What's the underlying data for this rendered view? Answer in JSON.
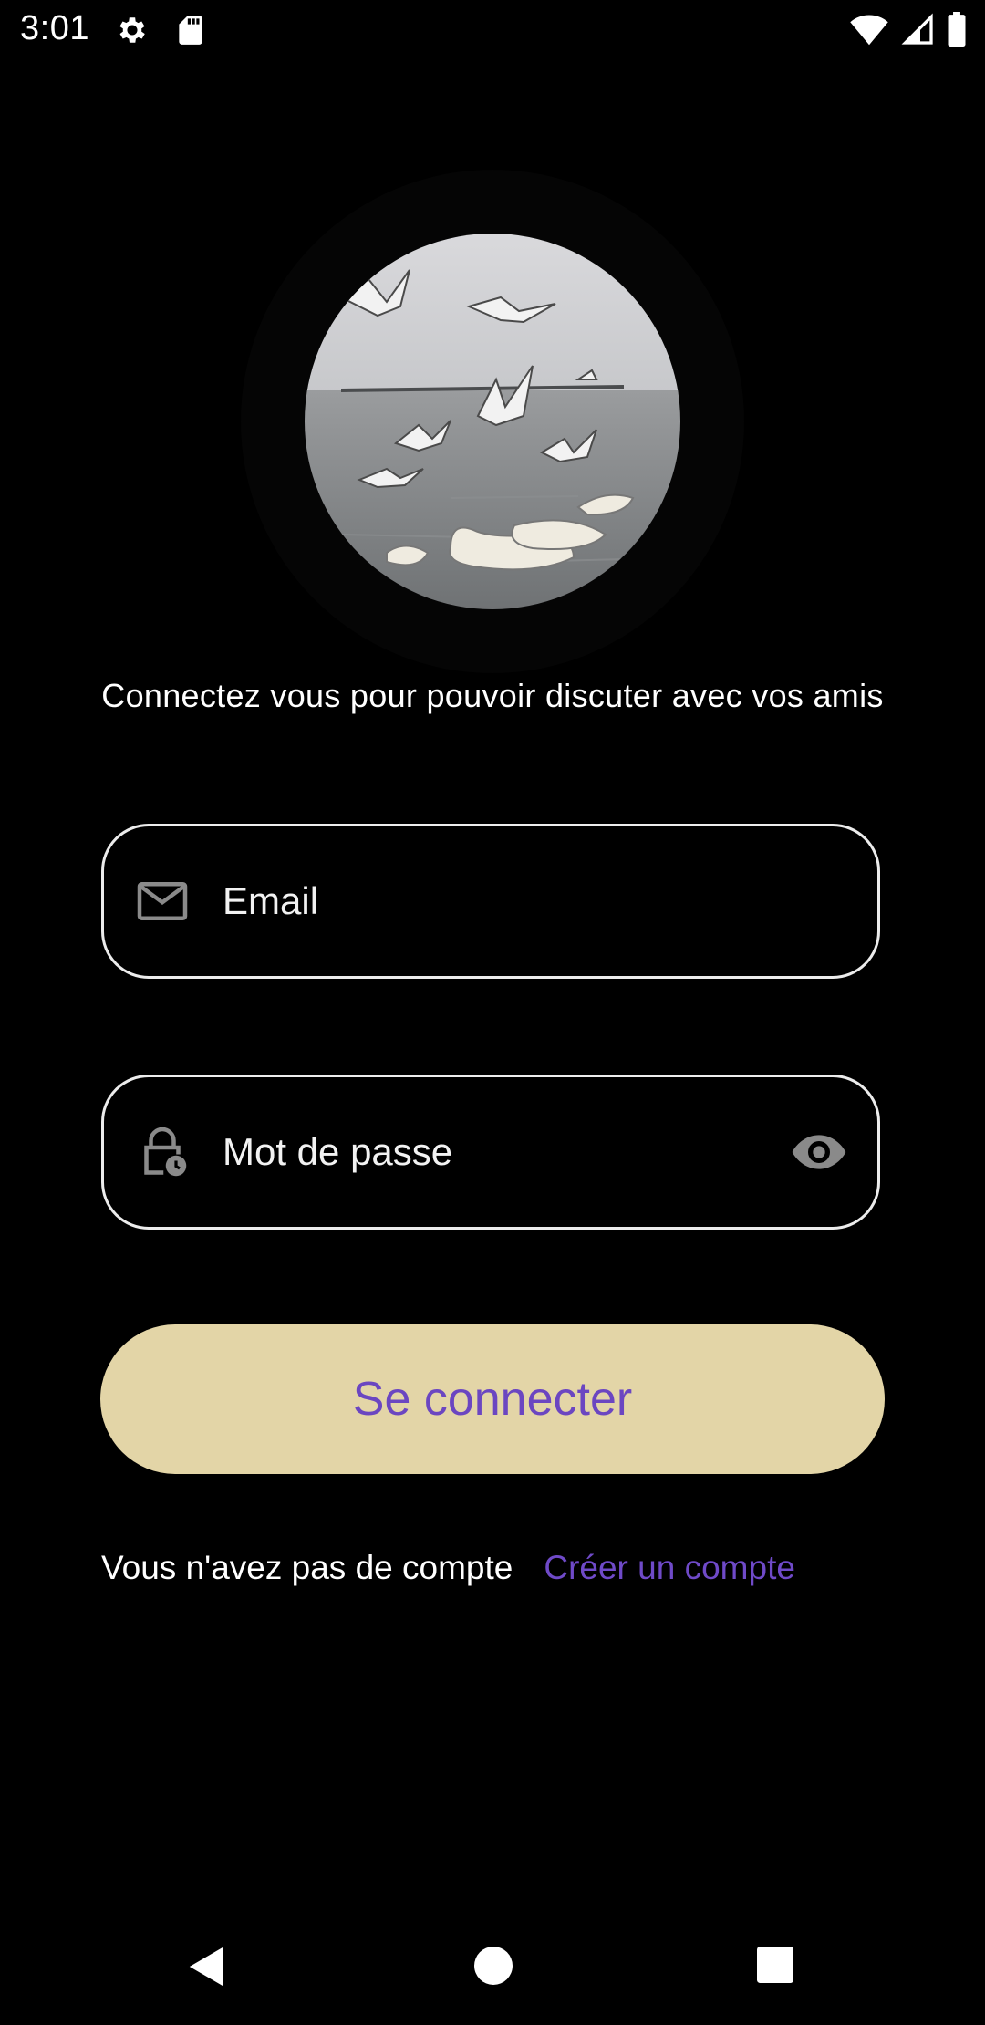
{
  "status_bar": {
    "time": "3:01",
    "icons": [
      "settings-icon",
      "sd-card-icon",
      "wifi-icon",
      "signal-icon",
      "battery-icon"
    ]
  },
  "profile": {
    "image": "seagulls-and-swans-photo"
  },
  "subtitle": "Connectez vous pour pouvoir discuter avec vos amis",
  "form": {
    "email_placeholder": "Email",
    "email_value": "",
    "password_placeholder": "Mot de passe",
    "password_value": "",
    "login_label": "Se connecter"
  },
  "signup": {
    "text": "Vous n'avez pas de compte",
    "link_label": "Créer un compte"
  },
  "nav_bar": {
    "icons": [
      "back-icon",
      "home-icon",
      "recents-icon"
    ]
  },
  "colors": {
    "background": "#000000",
    "field_border": "#ececec",
    "button_bg": "#e3d5a7",
    "accent": "#6f4ac8",
    "icon_gray": "#8a8a8a"
  }
}
